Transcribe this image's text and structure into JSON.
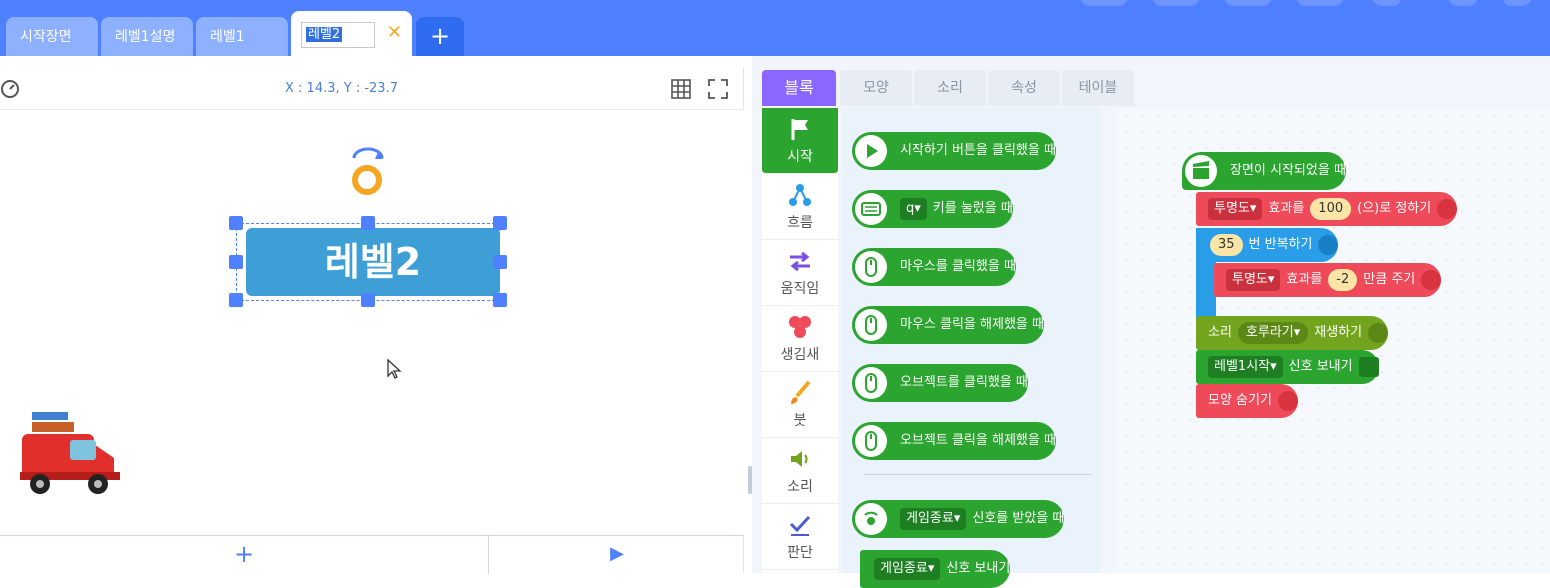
{
  "tabs": [
    {
      "label": "시작장면"
    },
    {
      "label": "레벨1설명"
    },
    {
      "label": "레벨1"
    }
  ],
  "active_tab": {
    "label": "레벨2",
    "close": "✕"
  },
  "add_tab": "+",
  "stage": {
    "coords": "X : 14.3, Y : -23.7",
    "sprite_text": "레벨2",
    "add_label": "+",
    "play_label": "▶"
  },
  "right_tabs": [
    {
      "label": "블록"
    },
    {
      "label": "모양"
    },
    {
      "label": "소리"
    },
    {
      "label": "속성"
    },
    {
      "label": "테이블"
    }
  ],
  "categories": [
    {
      "label": "시작"
    },
    {
      "label": "흐름"
    },
    {
      "label": "움직임"
    },
    {
      "label": "생김새"
    },
    {
      "label": "붓"
    },
    {
      "label": "소리"
    },
    {
      "label": "판단"
    }
  ],
  "palette": [
    {
      "text": "시작하기 버튼을 클릭했을 때"
    },
    {
      "dd": "q▾",
      "text": "키를 눌렀을 때"
    },
    {
      "text": "마우스를 클릭했을 때"
    },
    {
      "text": "마우스 클릭을 해제했을 때"
    },
    {
      "text": "오브젝트를 클릭했을 때"
    },
    {
      "text": "오브젝트 클릭을 해제했을 때"
    },
    {
      "dd": "게임종료▾",
      "text": "신호를 받았을 때"
    },
    {
      "dd": "게임종료▾",
      "text": "신호 보내기"
    }
  ],
  "script": {
    "hat": "장면이 시작되었을 때",
    "set_effect": {
      "dd": "투명도▾",
      "a": "효과를",
      "val": "100",
      "b": "(으)로 정하기"
    },
    "repeat": {
      "val": "35",
      "text": "번 반복하기"
    },
    "change_effect": {
      "dd": "투명도▾",
      "a": "효과를",
      "val": "-2",
      "b": "만큼 주기"
    },
    "sound": {
      "a": "소리",
      "dd": "호루라기▾",
      "b": "재생하기"
    },
    "signal": {
      "dd": "레벨1시작▾",
      "text": "신호 보내기"
    },
    "hide": "모양 숨기기"
  },
  "colors": {
    "topbar": "#4f80ff",
    "block_tab": "#8b67ff",
    "start": "#2ca430",
    "looks": "#ef4a5a",
    "flow": "#2a9de8",
    "sound": "#72a41d"
  }
}
